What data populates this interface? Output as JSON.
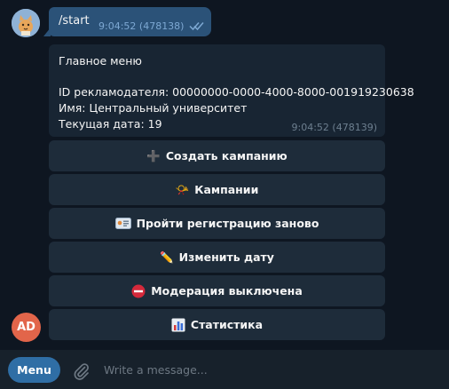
{
  "outgoing": {
    "text": "/start",
    "time": "9:04:52 (478138)"
  },
  "incoming": {
    "lines": [
      "Главное меню",
      "",
      "ID рекламодателя: 00000000-0000-4000-8000-001919230638",
      "Имя: Центральный университет",
      "Текущая дата: 19"
    ],
    "time": "9:04:52 (478139)"
  },
  "keyboard": [
    {
      "icon": "plus-icon",
      "emoji": "➕",
      "label": "Создать кампанию"
    },
    {
      "icon": "megaphone-icon",
      "emoji": "📯",
      "label": "Кампании"
    },
    {
      "icon": "id-card-icon",
      "emoji": "🪪",
      "label": "Пройти регистрацию заново"
    },
    {
      "icon": "pencil-icon",
      "emoji": "✏️",
      "label": "Изменить дату"
    },
    {
      "icon": "no-entry-icon",
      "emoji": "⛔",
      "label": "Модерация выключена"
    },
    {
      "icon": "bar-chart-icon",
      "emoji": "📊",
      "label": "Статистика"
    }
  ],
  "bot_avatar": {
    "initials": "AD",
    "color": "#e2654a"
  },
  "composer": {
    "menu_label": "Menu",
    "placeholder": "Write a message..."
  },
  "colors": {
    "background": "#0e1621",
    "outgoing_bubble": "#2b5278",
    "incoming_bubble": "#182533",
    "keyboard_button": "#1e2c3a",
    "menu_button": "#2f6ea5",
    "composer": "#17212b"
  }
}
